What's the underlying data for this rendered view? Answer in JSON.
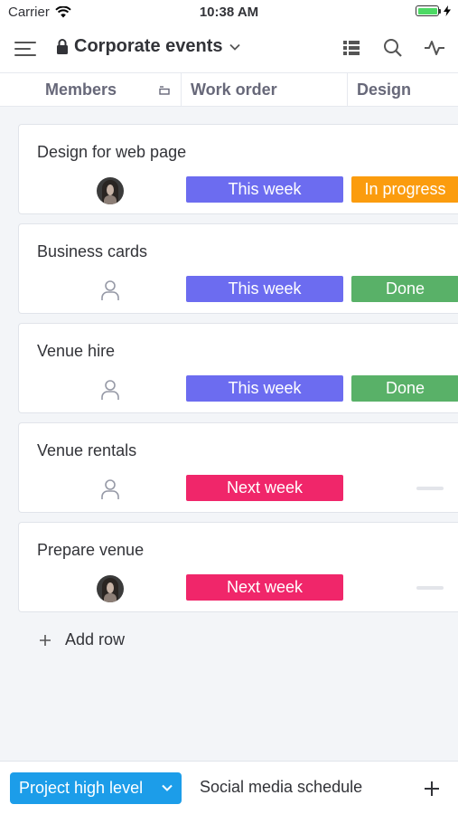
{
  "status_bar": {
    "carrier": "Carrier",
    "time": "10:38 AM"
  },
  "header": {
    "title": "Corporate events"
  },
  "columns": {
    "members": "Members",
    "work_order": "Work order",
    "design": "Design"
  },
  "rows": [
    {
      "name": "Design for web page",
      "member": "avatar",
      "work_order": "This week",
      "design": "In progress"
    },
    {
      "name": "Business cards",
      "member": "person-icon",
      "work_order": "This week",
      "design": "Done"
    },
    {
      "name": "Venue hire",
      "member": "person-icon",
      "work_order": "This week",
      "design": "Done"
    },
    {
      "name": "Venue rentals",
      "member": "person-icon",
      "work_order": "Next week",
      "design": ""
    },
    {
      "name": "Prepare venue",
      "member": "avatar",
      "work_order": "Next week",
      "design": ""
    }
  ],
  "add_row_label": "Add row",
  "bottom_tabs": {
    "active": "Project high level",
    "other": "Social media schedule"
  },
  "colors": {
    "This week": "#6c6cf0",
    "Next week": "#f0266a",
    "In progress": "#fb9c0e",
    "Done": "#59b168",
    "tab_active": "#1c9de9"
  },
  "icons": [
    "wifi-icon",
    "battery-icon",
    "menu-icon",
    "lock-icon",
    "chevron-down-icon",
    "list-view-icon",
    "search-icon",
    "activity-icon",
    "collapse-icon",
    "person-icon",
    "plus-icon"
  ]
}
